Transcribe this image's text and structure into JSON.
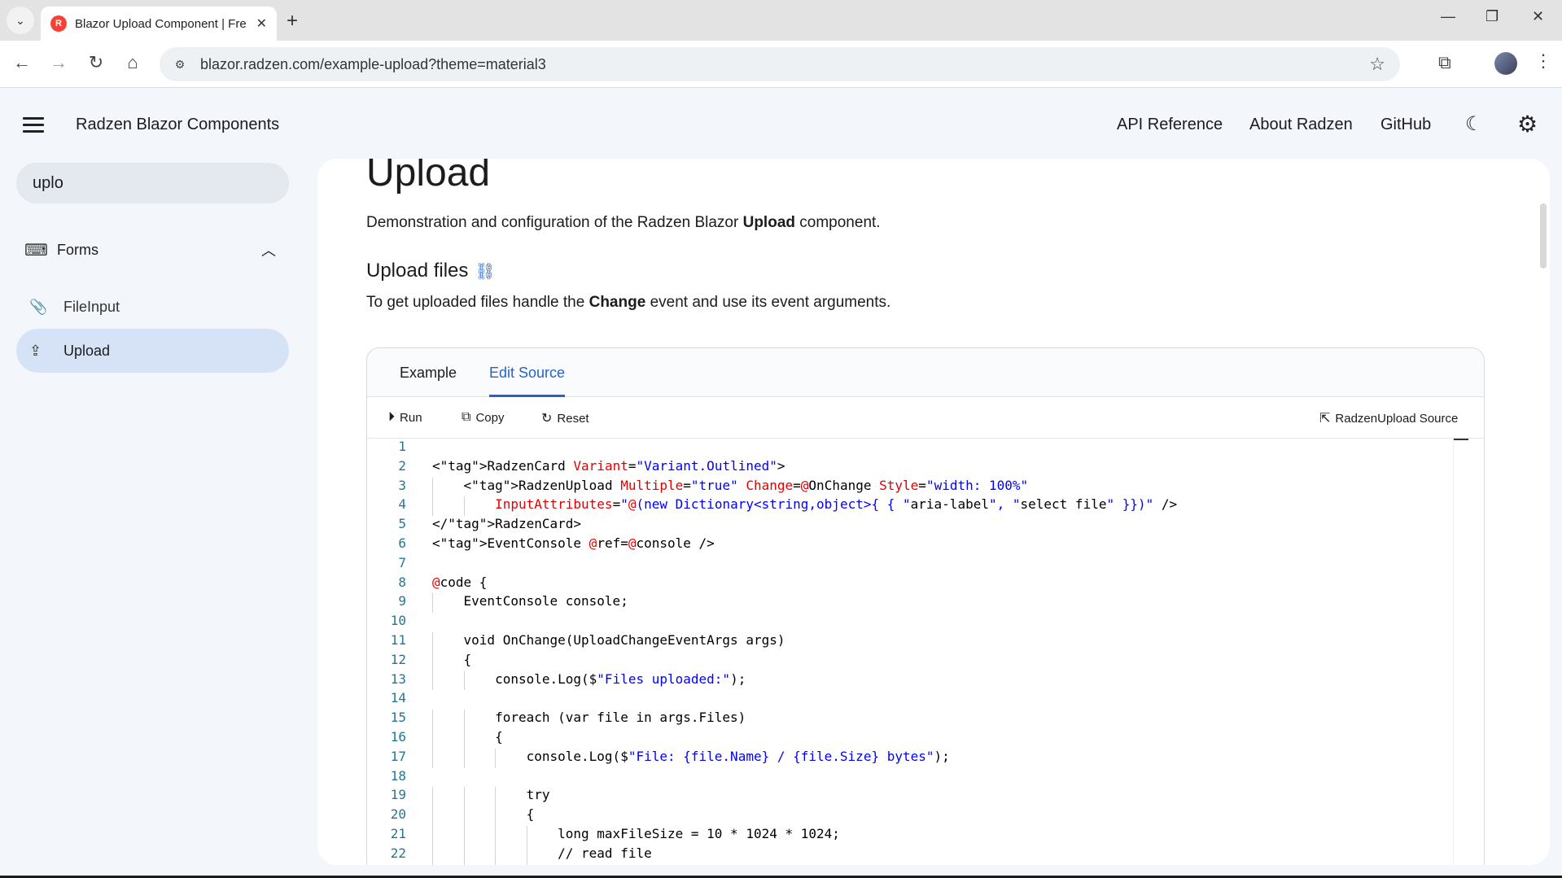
{
  "browser": {
    "tab_title": "Blazor Upload Component | Fre",
    "favicon_letter": "R",
    "url": "blazor.radzen.com/example-upload?theme=material3",
    "icons": {
      "tab_menu": "chevron-down-icon",
      "new_tab": "plus-icon",
      "back": "arrow-left-icon",
      "forward": "arrow-right-icon",
      "reload": "reload-icon",
      "home": "home-icon",
      "star": "star-icon",
      "extensions": "puzzle-icon",
      "menu": "kebab-icon"
    }
  },
  "header": {
    "title": "Radzen Blazor Components",
    "links": [
      "API Reference",
      "About Radzen",
      "GitHub"
    ]
  },
  "sidebar": {
    "search_value": "uplo",
    "group_label": "Forms",
    "items": [
      {
        "label": "FileInput",
        "icon": "paperclip-icon",
        "active": false
      },
      {
        "label": "Upload",
        "icon": "upload-icon",
        "active": true
      }
    ]
  },
  "main": {
    "title": "Upload",
    "description_pre": "Demonstration and configuration of the Radzen Blazor ",
    "description_bold": "Upload",
    "description_post": " component.",
    "section_title": "Upload files",
    "section_sub_pre": "To get uploaded files handle the ",
    "section_sub_bold": "Change",
    "section_sub_post": " event and use its event arguments."
  },
  "card": {
    "tabs": [
      "Example",
      "Edit Source"
    ],
    "active_tab": "Edit Source",
    "toolbar": {
      "run": "Run",
      "copy": "Copy",
      "reset": "Reset",
      "source": "RadzenUpload Source"
    },
    "code_lines": [
      "",
      "<RadzenCard Variant=\"Variant.Outlined\">",
      "    <RadzenUpload Multiple=\"true\" Change=@OnChange Style=\"width: 100%\"",
      "        InputAttributes=\"@(new Dictionary<string,object>{ { \"aria-label\", \"select file\" }})\" />",
      "</RadzenCard>",
      "<EventConsole @ref=@console />",
      "",
      "@code {",
      "    EventConsole console;",
      "",
      "    void OnChange(UploadChangeEventArgs args)",
      "    {",
      "        console.Log($\"Files uploaded:\");",
      "",
      "        foreach (var file in args.Files)",
      "        {",
      "            console.Log($\"File: {file.Name} / {file.Size} bytes\");",
      "",
      "            try",
      "            {",
      "                long maxFileSize = 10 * 1024 * 1024;",
      "                // read file"
    ]
  }
}
